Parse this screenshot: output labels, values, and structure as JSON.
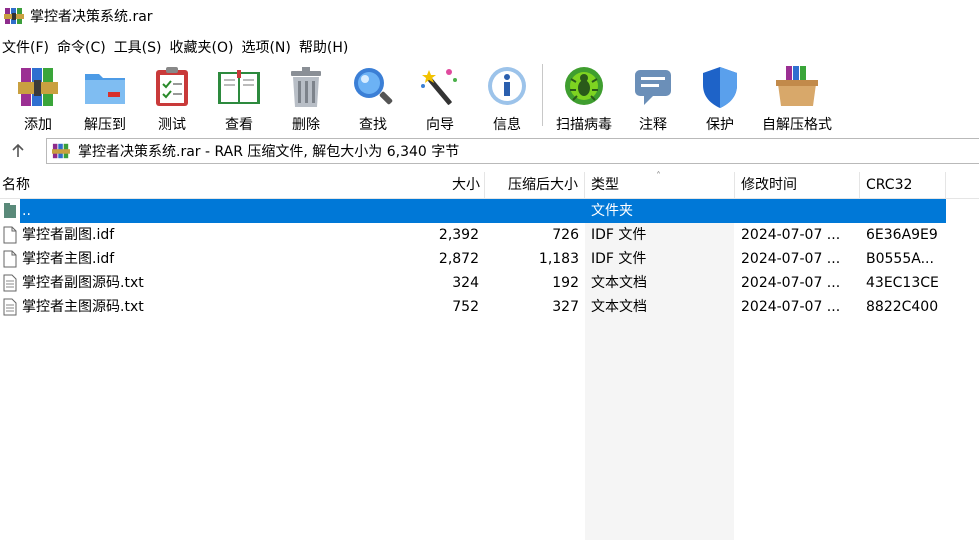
{
  "window": {
    "title": "掌控者决策系统.rar"
  },
  "menu": [
    {
      "label": "文件(F)"
    },
    {
      "label": "命令(C)"
    },
    {
      "label": "工具(S)"
    },
    {
      "label": "收藏夹(O)"
    },
    {
      "label": "选项(N)"
    },
    {
      "label": "帮助(H)"
    }
  ],
  "toolbar": [
    {
      "label": "添加",
      "icon": "add-archive-icon"
    },
    {
      "label": "解压到",
      "icon": "extract-folder-icon"
    },
    {
      "label": "测试",
      "icon": "test-clipboard-icon"
    },
    {
      "label": "查看",
      "icon": "view-book-icon"
    },
    {
      "label": "删除",
      "icon": "trash-can-icon"
    },
    {
      "label": "查找",
      "icon": "magnifier-icon"
    },
    {
      "label": "向导",
      "icon": "magic-wand-icon"
    },
    {
      "label": "信息",
      "icon": "info-icon"
    },
    {
      "label": "扫描病毒",
      "icon": "virus-scan-icon"
    },
    {
      "label": "注释",
      "icon": "comment-icon"
    },
    {
      "label": "保护",
      "icon": "shield-icon"
    },
    {
      "label": "自解压格式",
      "icon": "sfx-box-icon"
    }
  ],
  "address": {
    "text": "掌控者决策系统.rar - RAR 压缩文件, 解包大小为 6,340 字节"
  },
  "columns": {
    "name": "名称",
    "size": "大小",
    "packed": "压缩后大小",
    "type": "类型",
    "modified": "修改时间",
    "crc": "CRC32"
  },
  "rows": [
    {
      "name": "..",
      "size": "",
      "packed": "",
      "type": "文件夹",
      "modified": "",
      "crc": "",
      "selected": true
    },
    {
      "name": "掌控者副图.idf",
      "size": "2,392",
      "packed": "726",
      "type": "IDF 文件",
      "modified": "2024-07-07 ...",
      "crc": "6E36A9E9"
    },
    {
      "name": "掌控者主图.idf",
      "size": "2,872",
      "packed": "1,183",
      "type": "IDF 文件",
      "modified": "2024-07-07 ...",
      "crc": "B0555A..."
    },
    {
      "name": "掌控者副图源码.txt",
      "size": "324",
      "packed": "192",
      "type": "文本文档",
      "modified": "2024-07-07 ...",
      "crc": "43EC13CE"
    },
    {
      "name": "掌控者主图源码.txt",
      "size": "752",
      "packed": "327",
      "type": "文本文档",
      "modified": "2024-07-07 ...",
      "crc": "8822C400"
    }
  ],
  "colors": {
    "selection": "#0078d7",
    "type_column_bg": "#f5f5f5"
  }
}
